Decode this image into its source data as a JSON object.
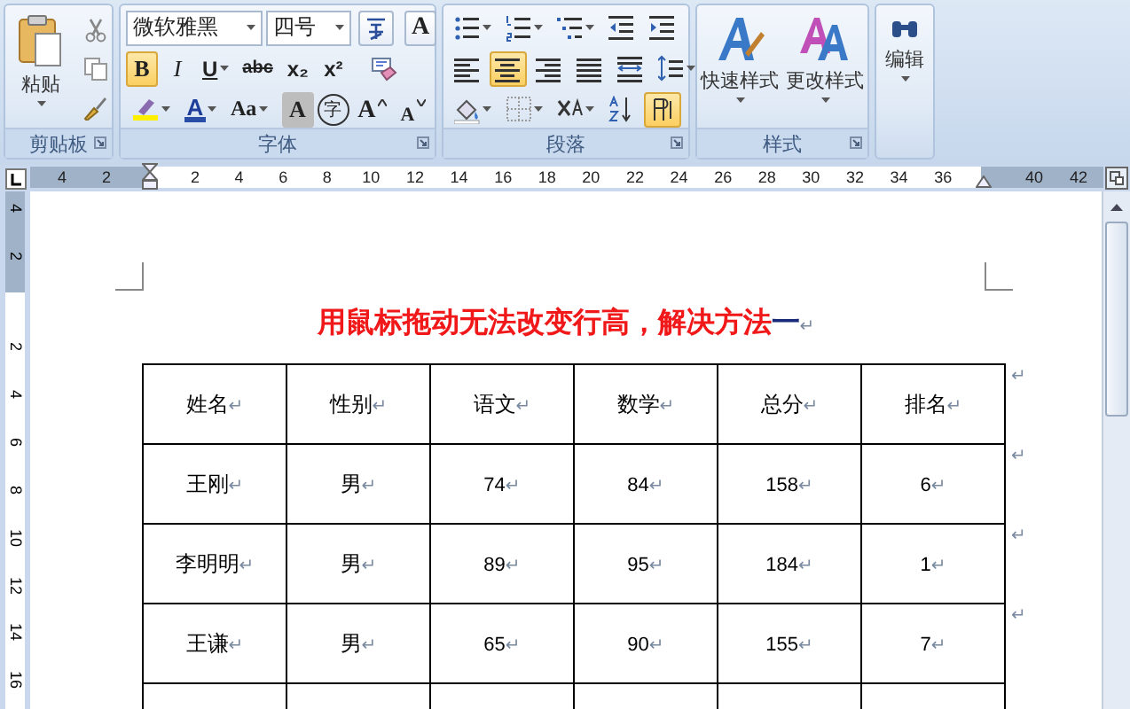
{
  "ribbon": {
    "clipboard": {
      "label": "剪贴板",
      "paste_label": "粘贴"
    },
    "font": {
      "label": "字体",
      "font_name": "微软雅黑",
      "font_size": "四号",
      "row1_buttons": [
        {
          "kind": "phonetic"
        },
        {
          "kind": "char-border",
          "label": "A"
        }
      ],
      "row2_buttons": [
        {
          "kind": "bold",
          "label": "B",
          "selected": true
        },
        {
          "kind": "italic",
          "label": "I",
          "selected": false
        },
        {
          "kind": "underline",
          "label": "U",
          "selected": false
        },
        {
          "kind": "strike",
          "label": "abc",
          "selected": false
        },
        {
          "kind": "sub",
          "label": "x₂",
          "selected": false
        },
        {
          "kind": "sup",
          "label": "x²",
          "selected": false
        },
        {
          "kind": "clear",
          "selected": false
        }
      ],
      "row3_buttons": [
        {
          "kind": "highlight"
        },
        {
          "kind": "font-color",
          "label": "A"
        },
        {
          "kind": "case",
          "label": "Aa"
        },
        {
          "kind": "shading",
          "label": "A"
        },
        {
          "kind": "enclose",
          "label": "字"
        },
        {
          "kind": "grow",
          "label": "A"
        },
        {
          "kind": "shrink",
          "label": "A"
        }
      ]
    },
    "paragraph": {
      "label": "段落",
      "row1_buttons": [
        {
          "kind": "bullets"
        },
        {
          "kind": "numbering"
        },
        {
          "kind": "multilevel"
        },
        {
          "kind": "outdent"
        },
        {
          "kind": "indent"
        }
      ],
      "alignments": [
        {
          "kind": "left",
          "selected": false
        },
        {
          "kind": "center",
          "selected": true
        },
        {
          "kind": "right",
          "selected": false
        },
        {
          "kind": "justify",
          "selected": false
        },
        {
          "kind": "distributed",
          "selected": false
        }
      ],
      "row3_buttons": [
        {
          "kind": "shading",
          "selected": false
        },
        {
          "kind": "border",
          "selected": false
        },
        {
          "kind": "asian-layout",
          "selected": false
        },
        {
          "kind": "sort",
          "selected": false
        },
        {
          "kind": "show-marks",
          "selected": true
        }
      ]
    },
    "styles": {
      "label": "样式",
      "buttons": [
        {
          "kind": "quick",
          "label": "快速样式"
        },
        {
          "kind": "change",
          "label": "更改样式"
        }
      ]
    },
    "editing": {
      "label": "编辑"
    }
  },
  "ruler": {
    "left_labels": [
      "4",
      "2"
    ],
    "labels": [
      "2",
      "4",
      "6",
      "8",
      "10",
      "12",
      "14",
      "16",
      "18",
      "20",
      "22",
      "24",
      "26",
      "28",
      "30",
      "32",
      "34",
      "36"
    ],
    "right_labels": [
      "40",
      "42"
    ]
  },
  "vertical_ruler": {
    "top_labels": [
      "4",
      "2"
    ],
    "labels": [
      "2",
      "4",
      "6",
      "8",
      "10",
      "12",
      "14",
      "16"
    ]
  },
  "document": {
    "title": "用鼠标拖动无法改变行高，解决方法",
    "selected_text": "一",
    "title_mark": "↵",
    "table": {
      "header": [
        {
          "text": "姓名",
          "mark": "↵"
        },
        {
          "text": "性别",
          "mark": "↵"
        },
        {
          "text": "语文",
          "mark": "↵"
        },
        {
          "text": "数学",
          "mark": "↵"
        },
        {
          "text": "总分",
          "mark": "↵"
        },
        {
          "text": "排名",
          "mark": "↵"
        }
      ],
      "header_end_mark": "↵",
      "rows": [
        {
          "cells": [
            {
              "text": "王刚",
              "mark": "↵"
            },
            {
              "text": "男",
              "mark": "↵"
            },
            {
              "text": "74",
              "mark": "↵"
            },
            {
              "text": "84",
              "mark": "↵"
            },
            {
              "text": "158",
              "mark": "↵"
            },
            {
              "text": "6",
              "mark": "↵"
            }
          ],
          "end_mark": "↵"
        },
        {
          "cells": [
            {
              "text": "李明明",
              "mark": "↵"
            },
            {
              "text": "男",
              "mark": "↵"
            },
            {
              "text": "89",
              "mark": "↵"
            },
            {
              "text": "95",
              "mark": "↵"
            },
            {
              "text": "184",
              "mark": "↵"
            },
            {
              "text": "1",
              "mark": "↵"
            }
          ],
          "end_mark": "↵"
        },
        {
          "cells": [
            {
              "text": "王谦",
              "mark": "↵"
            },
            {
              "text": "男",
              "mark": "↵"
            },
            {
              "text": "65",
              "mark": "↵"
            },
            {
              "text": "90",
              "mark": "↵"
            },
            {
              "text": "155",
              "mark": "↵"
            },
            {
              "text": "7",
              "mark": "↵"
            }
          ],
          "end_mark": "↵"
        }
      ]
    }
  }
}
